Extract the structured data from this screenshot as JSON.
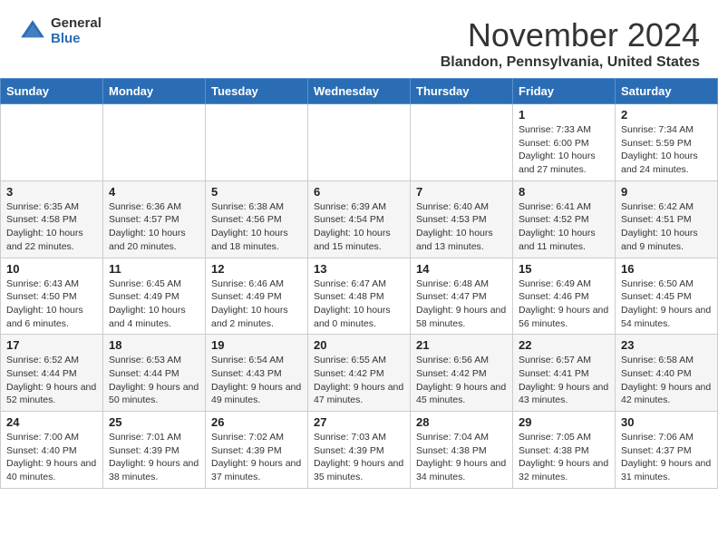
{
  "header": {
    "logo_general": "General",
    "logo_blue": "Blue",
    "month_title": "November 2024",
    "location": "Blandon, Pennsylvania, United States"
  },
  "weekdays": [
    "Sunday",
    "Monday",
    "Tuesday",
    "Wednesday",
    "Thursday",
    "Friday",
    "Saturday"
  ],
  "weeks": [
    [
      {
        "day": "",
        "sunrise": "",
        "sunset": "",
        "daylight": ""
      },
      {
        "day": "",
        "sunrise": "",
        "sunset": "",
        "daylight": ""
      },
      {
        "day": "",
        "sunrise": "",
        "sunset": "",
        "daylight": ""
      },
      {
        "day": "",
        "sunrise": "",
        "sunset": "",
        "daylight": ""
      },
      {
        "day": "",
        "sunrise": "",
        "sunset": "",
        "daylight": ""
      },
      {
        "day": "1",
        "sunrise": "Sunrise: 7:33 AM",
        "sunset": "Sunset: 6:00 PM",
        "daylight": "Daylight: 10 hours and 27 minutes."
      },
      {
        "day": "2",
        "sunrise": "Sunrise: 7:34 AM",
        "sunset": "Sunset: 5:59 PM",
        "daylight": "Daylight: 10 hours and 24 minutes."
      }
    ],
    [
      {
        "day": "3",
        "sunrise": "Sunrise: 6:35 AM",
        "sunset": "Sunset: 4:58 PM",
        "daylight": "Daylight: 10 hours and 22 minutes."
      },
      {
        "day": "4",
        "sunrise": "Sunrise: 6:36 AM",
        "sunset": "Sunset: 4:57 PM",
        "daylight": "Daylight: 10 hours and 20 minutes."
      },
      {
        "day": "5",
        "sunrise": "Sunrise: 6:38 AM",
        "sunset": "Sunset: 4:56 PM",
        "daylight": "Daylight: 10 hours and 18 minutes."
      },
      {
        "day": "6",
        "sunrise": "Sunrise: 6:39 AM",
        "sunset": "Sunset: 4:54 PM",
        "daylight": "Daylight: 10 hours and 15 minutes."
      },
      {
        "day": "7",
        "sunrise": "Sunrise: 6:40 AM",
        "sunset": "Sunset: 4:53 PM",
        "daylight": "Daylight: 10 hours and 13 minutes."
      },
      {
        "day": "8",
        "sunrise": "Sunrise: 6:41 AM",
        "sunset": "Sunset: 4:52 PM",
        "daylight": "Daylight: 10 hours and 11 minutes."
      },
      {
        "day": "9",
        "sunrise": "Sunrise: 6:42 AM",
        "sunset": "Sunset: 4:51 PM",
        "daylight": "Daylight: 10 hours and 9 minutes."
      }
    ],
    [
      {
        "day": "10",
        "sunrise": "Sunrise: 6:43 AM",
        "sunset": "Sunset: 4:50 PM",
        "daylight": "Daylight: 10 hours and 6 minutes."
      },
      {
        "day": "11",
        "sunrise": "Sunrise: 6:45 AM",
        "sunset": "Sunset: 4:49 PM",
        "daylight": "Daylight: 10 hours and 4 minutes."
      },
      {
        "day": "12",
        "sunrise": "Sunrise: 6:46 AM",
        "sunset": "Sunset: 4:49 PM",
        "daylight": "Daylight: 10 hours and 2 minutes."
      },
      {
        "day": "13",
        "sunrise": "Sunrise: 6:47 AM",
        "sunset": "Sunset: 4:48 PM",
        "daylight": "Daylight: 10 hours and 0 minutes."
      },
      {
        "day": "14",
        "sunrise": "Sunrise: 6:48 AM",
        "sunset": "Sunset: 4:47 PM",
        "daylight": "Daylight: 9 hours and 58 minutes."
      },
      {
        "day": "15",
        "sunrise": "Sunrise: 6:49 AM",
        "sunset": "Sunset: 4:46 PM",
        "daylight": "Daylight: 9 hours and 56 minutes."
      },
      {
        "day": "16",
        "sunrise": "Sunrise: 6:50 AM",
        "sunset": "Sunset: 4:45 PM",
        "daylight": "Daylight: 9 hours and 54 minutes."
      }
    ],
    [
      {
        "day": "17",
        "sunrise": "Sunrise: 6:52 AM",
        "sunset": "Sunset: 4:44 PM",
        "daylight": "Daylight: 9 hours and 52 minutes."
      },
      {
        "day": "18",
        "sunrise": "Sunrise: 6:53 AM",
        "sunset": "Sunset: 4:44 PM",
        "daylight": "Daylight: 9 hours and 50 minutes."
      },
      {
        "day": "19",
        "sunrise": "Sunrise: 6:54 AM",
        "sunset": "Sunset: 4:43 PM",
        "daylight": "Daylight: 9 hours and 49 minutes."
      },
      {
        "day": "20",
        "sunrise": "Sunrise: 6:55 AM",
        "sunset": "Sunset: 4:42 PM",
        "daylight": "Daylight: 9 hours and 47 minutes."
      },
      {
        "day": "21",
        "sunrise": "Sunrise: 6:56 AM",
        "sunset": "Sunset: 4:42 PM",
        "daylight": "Daylight: 9 hours and 45 minutes."
      },
      {
        "day": "22",
        "sunrise": "Sunrise: 6:57 AM",
        "sunset": "Sunset: 4:41 PM",
        "daylight": "Daylight: 9 hours and 43 minutes."
      },
      {
        "day": "23",
        "sunrise": "Sunrise: 6:58 AM",
        "sunset": "Sunset: 4:40 PM",
        "daylight": "Daylight: 9 hours and 42 minutes."
      }
    ],
    [
      {
        "day": "24",
        "sunrise": "Sunrise: 7:00 AM",
        "sunset": "Sunset: 4:40 PM",
        "daylight": "Daylight: 9 hours and 40 minutes."
      },
      {
        "day": "25",
        "sunrise": "Sunrise: 7:01 AM",
        "sunset": "Sunset: 4:39 PM",
        "daylight": "Daylight: 9 hours and 38 minutes."
      },
      {
        "day": "26",
        "sunrise": "Sunrise: 7:02 AM",
        "sunset": "Sunset: 4:39 PM",
        "daylight": "Daylight: 9 hours and 37 minutes."
      },
      {
        "day": "27",
        "sunrise": "Sunrise: 7:03 AM",
        "sunset": "Sunset: 4:39 PM",
        "daylight": "Daylight: 9 hours and 35 minutes."
      },
      {
        "day": "28",
        "sunrise": "Sunrise: 7:04 AM",
        "sunset": "Sunset: 4:38 PM",
        "daylight": "Daylight: 9 hours and 34 minutes."
      },
      {
        "day": "29",
        "sunrise": "Sunrise: 7:05 AM",
        "sunset": "Sunset: 4:38 PM",
        "daylight": "Daylight: 9 hours and 32 minutes."
      },
      {
        "day": "30",
        "sunrise": "Sunrise: 7:06 AM",
        "sunset": "Sunset: 4:37 PM",
        "daylight": "Daylight: 9 hours and 31 minutes."
      }
    ]
  ]
}
